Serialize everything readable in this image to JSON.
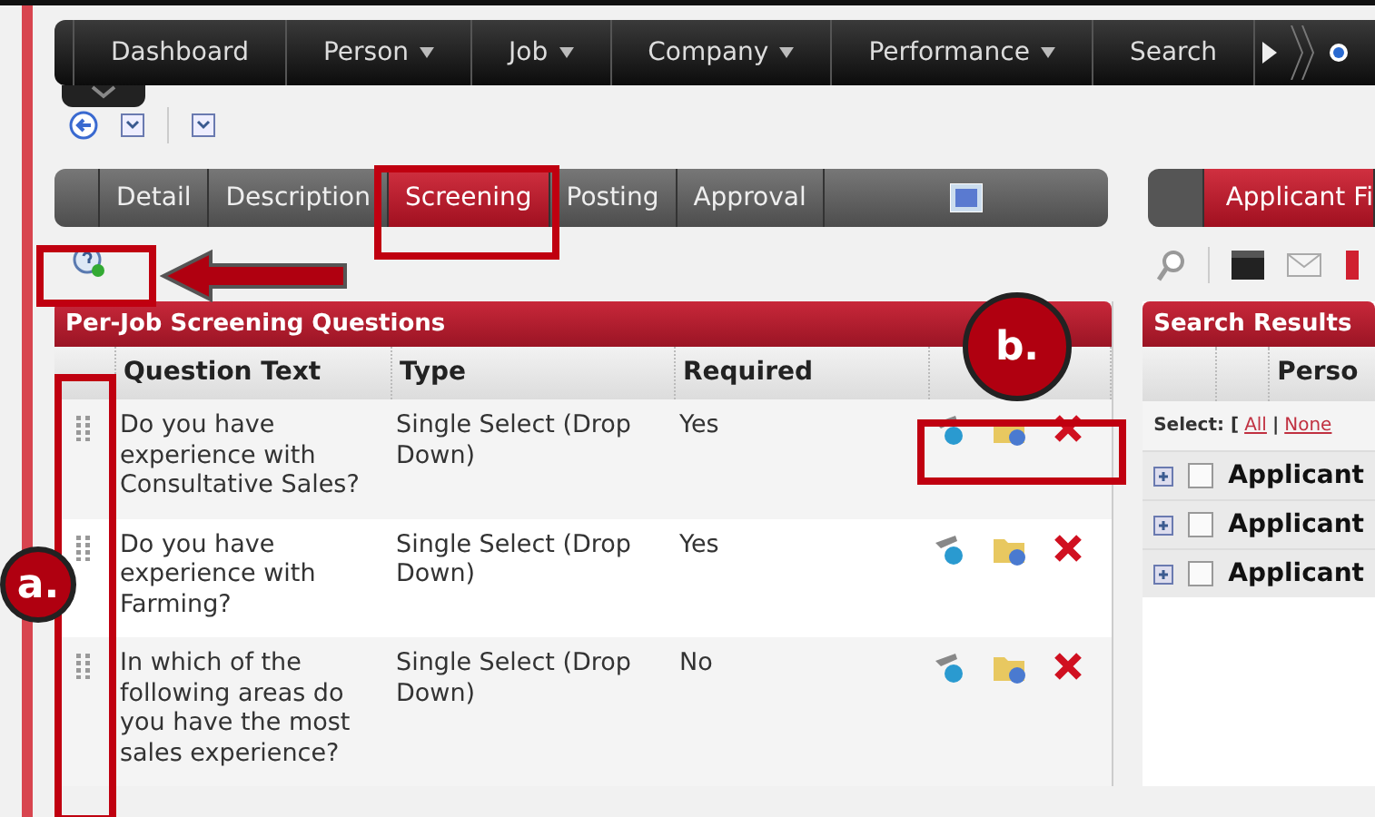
{
  "nav": {
    "items": [
      {
        "label": "Dashboard",
        "caret": false
      },
      {
        "label": "Person",
        "caret": true
      },
      {
        "label": "Job",
        "caret": true
      },
      {
        "label": "Company",
        "caret": true
      },
      {
        "label": "Performance",
        "caret": true
      },
      {
        "label": "Search",
        "caret": false
      }
    ]
  },
  "tabs": [
    {
      "label": "Detail",
      "selected": false
    },
    {
      "label": "Description",
      "selected": false
    },
    {
      "label": "Screening",
      "selected": true
    },
    {
      "label": "Posting",
      "selected": false
    },
    {
      "label": "Approval",
      "selected": false
    }
  ],
  "right_tabs": [
    {
      "label": "Applicant Fi",
      "selected": true
    }
  ],
  "questions_panel": {
    "title": "Per-Job Screening Questions",
    "columns": [
      "Question Text",
      "Type",
      "Required"
    ],
    "rows": [
      {
        "question": "Do you have experience with Consultative Sales?",
        "type": "Single Select (Drop Down)",
        "required": "Yes"
      },
      {
        "question": "Do you have experience with Farming?",
        "type": "Single Select (Drop Down)",
        "required": "Yes"
      },
      {
        "question": "In which of the following areas do you have the most sales experience?",
        "type": "Single Select (Drop Down)",
        "required": "No"
      }
    ]
  },
  "results_panel": {
    "title": "Search Results",
    "column": "Perso",
    "select_label": "Select: [",
    "select_links": [
      "All",
      "None"
    ],
    "select_separator": "|",
    "rows": [
      {
        "label": "Applicant",
        "checked": false
      },
      {
        "label": "Applicant",
        "checked": false
      },
      {
        "label": "Applicant",
        "checked": false
      }
    ]
  },
  "annotations": [
    {
      "kind": "box"
    },
    {
      "kind": "box"
    },
    {
      "kind": "arrow"
    },
    {
      "kind": "box"
    },
    {
      "kind": "box"
    },
    {
      "kind": "callout",
      "label": "a."
    },
    {
      "kind": "callout",
      "label": "b."
    }
  ]
}
